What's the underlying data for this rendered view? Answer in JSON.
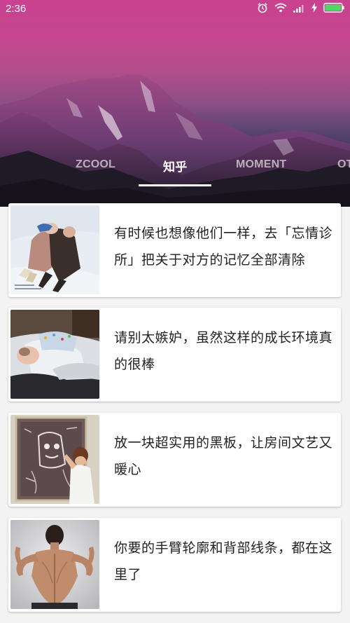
{
  "status_bar": {
    "time": "2:36",
    "icons": [
      "alarm-icon",
      "wifi-icon",
      "signal-icon",
      "charging-icon",
      "battery-icon"
    ]
  },
  "tabs": [
    {
      "label": "ZCOOL",
      "active": false
    },
    {
      "label": "知乎",
      "active": true
    },
    {
      "label": "MOMENT",
      "active": false
    },
    {
      "label": "OT",
      "active": false
    }
  ],
  "cards": [
    {
      "title": "有时候也想像他们一样，去「忘情诊所」把关于对方的记忆全部清除",
      "thumbnail": "couple-in-snow-image"
    },
    {
      "title": "请别太嫉妒，虽然这样的成长环境真的很棒",
      "thumbnail": "baby-sleeping-image"
    },
    {
      "title": "放一块超实用的黑板，让房间文艺又暖心",
      "thumbnail": "child-chalkboard-image"
    },
    {
      "title": "你要的手臂轮廓和背部线条，都在这里了",
      "thumbnail": "man-back-muscles-image"
    }
  ],
  "colors": {
    "header_top": "#c9418f",
    "header_bottom": "#2a2a3e",
    "background": "#f3f3f3",
    "card": "#ffffff",
    "battery": "#4cd964"
  }
}
